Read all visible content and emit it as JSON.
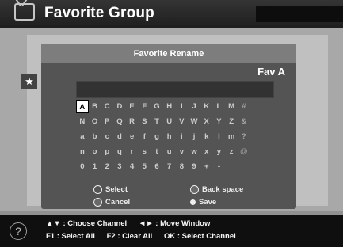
{
  "header": {
    "title": "Favorite Group"
  },
  "dialog": {
    "title": "Favorite Rename",
    "current_name": "Fav A",
    "name_field_value": "",
    "selected_key": "A",
    "keyboard_rows": [
      [
        "A",
        "B",
        "C",
        "D",
        "E",
        "F",
        "G",
        "H",
        "I",
        "J",
        "K",
        "L",
        "M",
        "#"
      ],
      [
        "N",
        "O",
        "P",
        "Q",
        "R",
        "S",
        "T",
        "U",
        "V",
        "W",
        "X",
        "Y",
        "Z",
        "&"
      ],
      [
        "a",
        "b",
        "c",
        "d",
        "e",
        "f",
        "g",
        "h",
        "i",
        "j",
        "k",
        "l",
        "m",
        "?"
      ],
      [
        "n",
        "o",
        "p",
        "q",
        "r",
        "s",
        "t",
        "u",
        "v",
        "w",
        "x",
        "y",
        "z",
        "@"
      ],
      [
        "0",
        "1",
        "2",
        "3",
        "4",
        "5",
        "6",
        "7",
        "8",
        "9",
        "+",
        "-",
        "_"
      ]
    ],
    "legend": {
      "select": "Select",
      "backspace": "Back space",
      "cancel": "Cancel",
      "save": "Save"
    }
  },
  "help": {
    "line1": {
      "choose": "▲▼ : Choose Channel",
      "move": "◄► : Move Window"
    },
    "line2": {
      "f1": "F1 : Select All",
      "f2": "F2 : Clear All",
      "ok": "OK : Select Channel"
    }
  },
  "icons": {
    "title": "tv-icon",
    "side": "star-icon",
    "help": "help-icon"
  }
}
